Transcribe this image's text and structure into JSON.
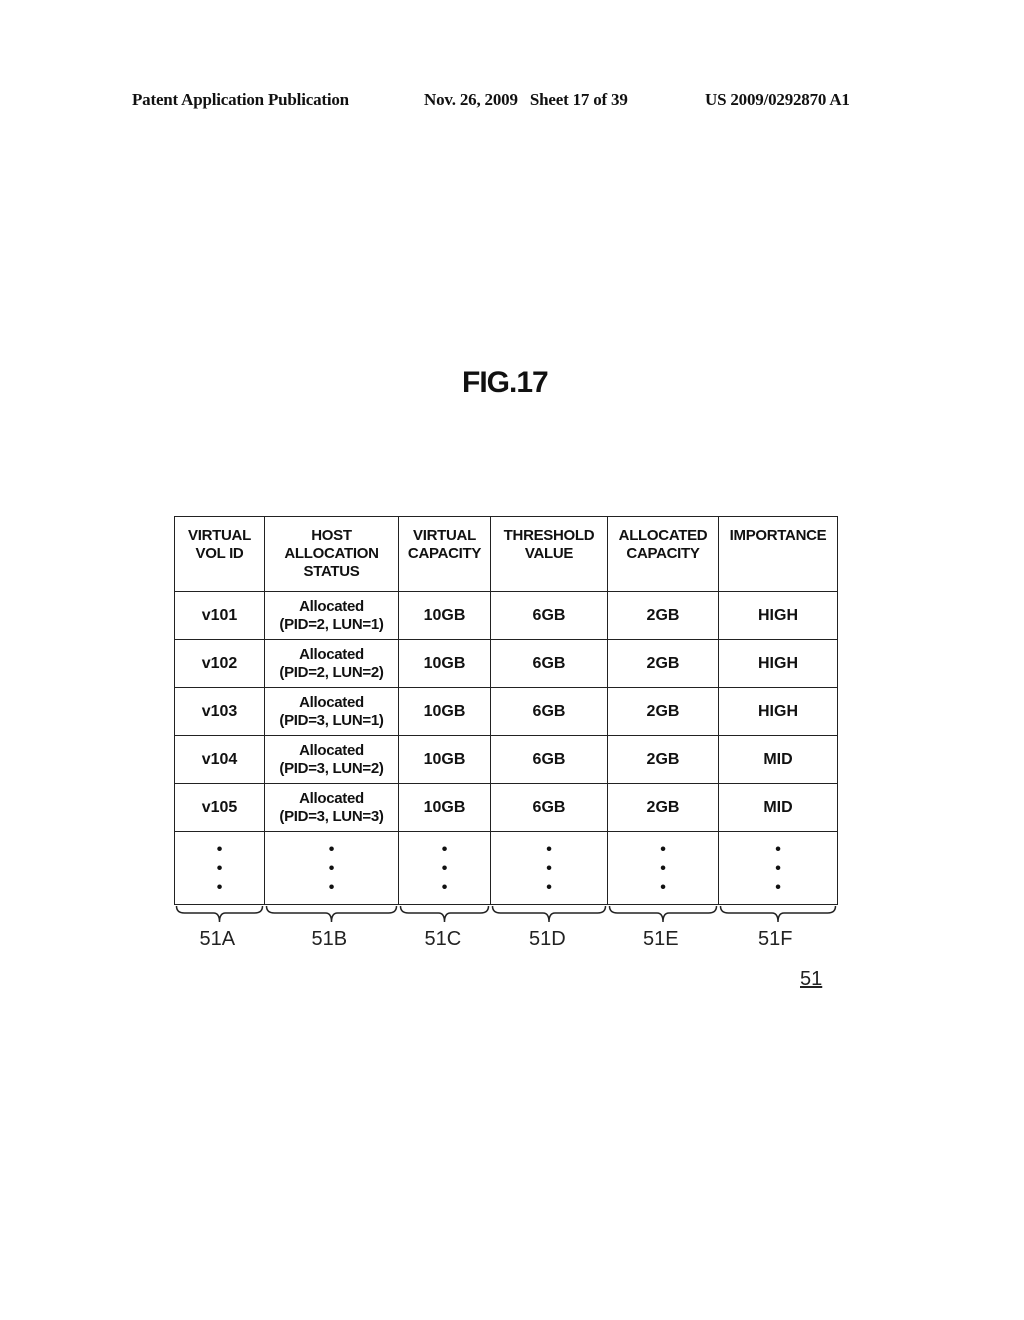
{
  "header": {
    "publication": "Patent Application Publication",
    "date_sheet": "Nov. 26, 2009   Sheet 17 of 39",
    "patent_number": "US 2009/0292870 A1"
  },
  "figure": {
    "title": "FIG.17",
    "reference": "51"
  },
  "table": {
    "headers": [
      [
        "VIRTUAL",
        "VOL ID"
      ],
      [
        "HOST",
        "ALLOCATION",
        "STATUS"
      ],
      [
        "VIRTUAL",
        "CAPACITY"
      ],
      [
        "THRESHOLD",
        "VALUE"
      ],
      [
        "ALLOCATED",
        "CAPACITY"
      ],
      [
        "IMPORTANCE"
      ]
    ],
    "rows": [
      {
        "vol_id": "v101",
        "status_line1": "Allocated",
        "status_line2": "(PID=2, LUN=1)",
        "virtual_capacity": "10GB",
        "threshold": "6GB",
        "allocated_capacity": "2GB",
        "importance": "HIGH"
      },
      {
        "vol_id": "v102",
        "status_line1": "Allocated",
        "status_line2": "(PID=2, LUN=2)",
        "virtual_capacity": "10GB",
        "threshold": "6GB",
        "allocated_capacity": "2GB",
        "importance": "HIGH"
      },
      {
        "vol_id": "v103",
        "status_line1": "Allocated",
        "status_line2": "(PID=3, LUN=1)",
        "virtual_capacity": "10GB",
        "threshold": "6GB",
        "allocated_capacity": "2GB",
        "importance": "HIGH"
      },
      {
        "vol_id": "v104",
        "status_line1": "Allocated",
        "status_line2": "(PID=3, LUN=2)",
        "virtual_capacity": "10GB",
        "threshold": "6GB",
        "allocated_capacity": "2GB",
        "importance": "MID"
      },
      {
        "vol_id": "v105",
        "status_line1": "Allocated",
        "status_line2": "(PID=3, LUN=3)",
        "virtual_capacity": "10GB",
        "threshold": "6GB",
        "allocated_capacity": "2GB",
        "importance": "MID"
      }
    ],
    "ellipsis": "•\n•\n•"
  },
  "column_refs": [
    "51A",
    "51B",
    "51C",
    "51D",
    "51E",
    "51F"
  ]
}
